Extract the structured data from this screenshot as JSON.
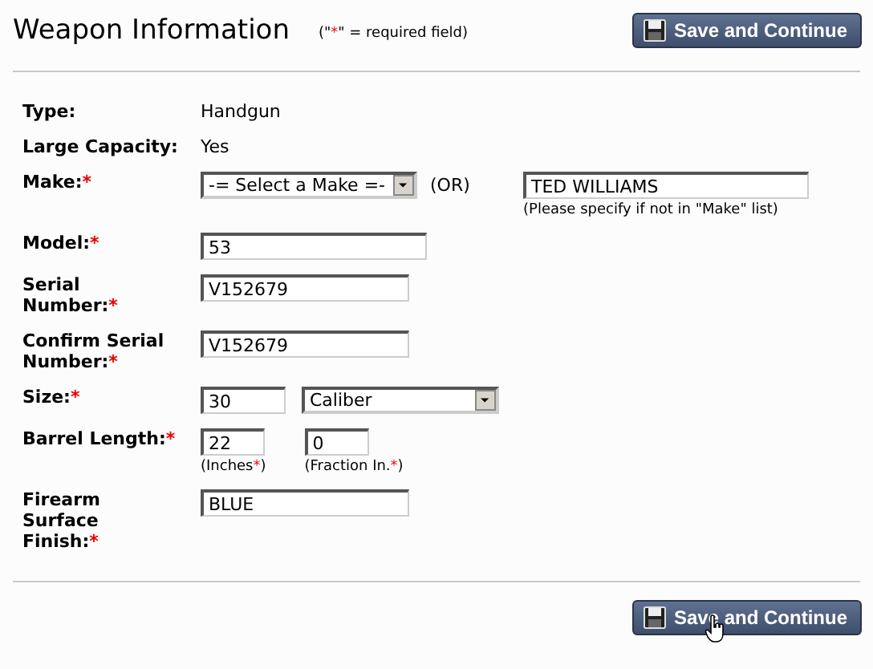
{
  "header": {
    "title": "Weapon Information",
    "note": [
      "(\"",
      "*",
      "\" = required field)"
    ],
    "save_button": "Save and Continue"
  },
  "rows": [
    {
      "kind": "static",
      "label": "Type:",
      "value": "Handgun"
    },
    {
      "kind": "static",
      "label": "Large Capacity:",
      "value": "Yes"
    },
    {
      "kind": "make",
      "label": "Make:",
      "mark": "*",
      "select": "-= Select a Make =-",
      "or": "(OR)",
      "value": "TED WILLIAMS",
      "hint": "(Please specify if not in \"Make\" list)"
    },
    {
      "kind": "input",
      "label": "Model:",
      "mark": "*",
      "value": "53"
    },
    {
      "kind": "input",
      "label": "Serial Number:",
      "mark": "*",
      "value": "V152679"
    },
    {
      "kind": "input",
      "label": "Confirm Serial Number:",
      "mark": "*",
      "value": "V152679"
    },
    {
      "kind": "size",
      "label": "Size:",
      "mark": "*",
      "value": "30",
      "select": "Caliber"
    },
    {
      "kind": "pair",
      "label": "Barrel Length:",
      "mark": "*",
      "inputs": [
        {
          "value": "22",
          "caption": [
            "(Inches",
            "*",
            ")"
          ]
        },
        {
          "value": "0",
          "caption": [
            "(Fraction In.",
            "*",
            ")"
          ]
        }
      ]
    },
    {
      "kind": "input",
      "label": "Firearm Surface Finish:",
      "mark": "*",
      "value": "BLUE"
    }
  ],
  "footer": {
    "save_button": "Save and Continue"
  }
}
